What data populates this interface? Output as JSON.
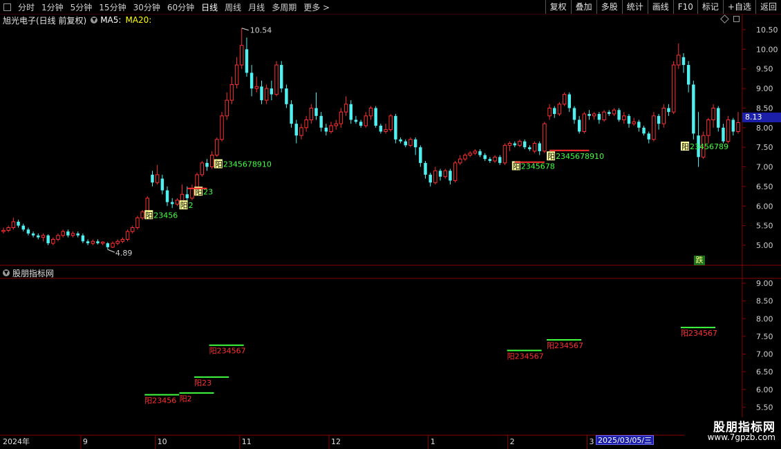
{
  "toolbar": {
    "periods": [
      "分时",
      "1分钟",
      "5分钟",
      "15分钟",
      "30分钟",
      "60分钟",
      "日线",
      "周线",
      "月线",
      "多周期",
      "更多 >"
    ],
    "active_period": "日线",
    "buttons": [
      "复权",
      "叠加",
      "多股",
      "统计",
      "画线",
      "F10",
      "标记",
      "+自选",
      "返回"
    ]
  },
  "info": {
    "stock_name": "旭光电子(日线 前复权)",
    "ma5_label": "MA5:",
    "ma20_label": "MA20:"
  },
  "indicator": {
    "name": "股朋指标网"
  },
  "colors": {
    "up": "#ff3030",
    "down": "#50f0f0",
    "grid": "#8a0000",
    "ma5": "#ffffff",
    "ma20": "#ffff00",
    "green_text": "#40ff40",
    "red_text": "#ff3030",
    "yang_bg": "#ffff99"
  },
  "price_axis": [
    "10.50",
    "10.00",
    "9.50",
    "9.00",
    "8.50",
    "8.00",
    "7.50",
    "7.00",
    "6.50",
    "6.00",
    "5.50",
    "5.00"
  ],
  "indicator_axis": [
    "9.00",
    "8.50",
    "8.00",
    "7.50",
    "7.00",
    "6.50",
    "6.00",
    "5.50",
    "5.00"
  ],
  "current_price": "8.13",
  "x_labels": [
    "2024年",
    "9",
    "10",
    "11",
    "12",
    "1",
    "2",
    "3"
  ],
  "cursor_date": "2025/03/05/三",
  "high_label": "10.54",
  "low_label": "4.89",
  "fall_badge": "跌",
  "main_markers": [
    {
      "yang": "阳",
      "text": "2345678910",
      "color": "green"
    },
    {
      "yang": "阳",
      "text": "23456",
      "color": "green"
    },
    {
      "yang": "阳",
      "text": "2",
      "color": "green"
    },
    {
      "yang": "阳",
      "text": "23",
      "color": "green"
    },
    {
      "yang": "阳",
      "text": "2345678",
      "color": "green"
    },
    {
      "yang": "阳",
      "text": "2345678910",
      "color": "green"
    },
    {
      "yang": "阳",
      "text": "23456789",
      "color": "green"
    }
  ],
  "indicator_markers": [
    {
      "text": "阳23456"
    },
    {
      "text": "阳2"
    },
    {
      "text": "阳23"
    },
    {
      "text": "阳234567"
    },
    {
      "text": "阳234567"
    },
    {
      "text": "阳234567"
    },
    {
      "text": "阳234567"
    }
  ],
  "watermark": {
    "line1": "股朋指标网",
    "line2": "www.7gpzb.com"
  },
  "chart_data": {
    "type": "candlestick",
    "title": "旭光电子(日线 前复权)",
    "ylim": [
      4.6,
      10.7
    ],
    "categories": [
      "2024-08",
      "2024-09",
      "2024-10",
      "2024-11",
      "2024-12",
      "2025-01",
      "2025-02",
      "2025-03"
    ],
    "annotations": {
      "max": 10.54,
      "min": 4.89,
      "last": 8.13
    },
    "series": [
      {
        "name": "",
        "values": [
          {
            "o": 5.35,
            "c": 5.38,
            "h": 5.45,
            "l": 5.3
          },
          {
            "o": 5.38,
            "c": 5.45,
            "h": 5.5,
            "l": 5.33
          },
          {
            "o": 5.45,
            "c": 5.6,
            "h": 5.7,
            "l": 5.4
          },
          {
            "o": 5.6,
            "c": 5.5,
            "h": 5.65,
            "l": 5.45
          },
          {
            "o": 5.5,
            "c": 5.4,
            "h": 5.55,
            "l": 5.35
          },
          {
            "o": 5.4,
            "c": 5.3,
            "h": 5.45,
            "l": 5.25
          },
          {
            "o": 5.3,
            "c": 5.25,
            "h": 5.35,
            "l": 5.2
          },
          {
            "o": 5.25,
            "c": 5.2,
            "h": 5.3,
            "l": 5.15
          },
          {
            "o": 5.2,
            "c": 5.25,
            "h": 5.3,
            "l": 5.1
          },
          {
            "o": 5.25,
            "c": 5.05,
            "h": 5.28,
            "l": 5.0
          },
          {
            "o": 5.05,
            "c": 5.15,
            "h": 5.2,
            "l": 5.0
          },
          {
            "o": 5.15,
            "c": 5.25,
            "h": 5.3,
            "l": 5.1
          },
          {
            "o": 5.25,
            "c": 5.35,
            "h": 5.4,
            "l": 5.2
          },
          {
            "o": 5.35,
            "c": 5.25,
            "h": 5.4,
            "l": 5.2
          },
          {
            "o": 5.25,
            "c": 5.3,
            "h": 5.35,
            "l": 5.2
          },
          {
            "o": 5.3,
            "c": 5.25,
            "h": 5.35,
            "l": 5.2
          },
          {
            "o": 5.25,
            "c": 5.1,
            "h": 5.3,
            "l": 5.05
          },
          {
            "o": 5.1,
            "c": 5.05,
            "h": 5.15,
            "l": 5.0
          },
          {
            "o": 5.05,
            "c": 5.1,
            "h": 5.15,
            "l": 5.0
          },
          {
            "o": 5.1,
            "c": 5.05,
            "h": 5.15,
            "l": 5.02
          },
          {
            "o": 5.05,
            "c": 5.08,
            "h": 5.1,
            "l": 5.0
          },
          {
            "o": 5.05,
            "c": 4.95,
            "h": 5.08,
            "l": 4.89
          },
          {
            "o": 4.95,
            "c": 5.05,
            "h": 5.1,
            "l": 4.93
          },
          {
            "o": 5.05,
            "c": 5.1,
            "h": 5.15,
            "l": 5.0
          },
          {
            "o": 5.1,
            "c": 5.15,
            "h": 5.2,
            "l": 5.05
          },
          {
            "o": 5.15,
            "c": 5.35,
            "h": 5.4,
            "l": 5.1
          },
          {
            "o": 5.35,
            "c": 5.45,
            "h": 5.5,
            "l": 5.3
          },
          {
            "o": 5.45,
            "c": 5.7,
            "h": 5.75,
            "l": 5.4
          },
          {
            "o": 5.7,
            "c": 5.85,
            "h": 5.9,
            "l": 5.65
          },
          {
            "o": 5.85,
            "c": 6.2,
            "h": 6.25,
            "l": 5.8
          },
          {
            "o": 6.8,
            "c": 6.6,
            "h": 6.9,
            "l": 6.5
          },
          {
            "o": 6.6,
            "c": 6.8,
            "h": 7.05,
            "l": 6.55
          },
          {
            "o": 6.7,
            "c": 6.4,
            "h": 6.8,
            "l": 6.3
          },
          {
            "o": 6.4,
            "c": 6.1,
            "h": 6.5,
            "l": 6.0
          },
          {
            "o": 6.1,
            "c": 6.05,
            "h": 6.2,
            "l": 5.95
          },
          {
            "o": 6.05,
            "c": 6.15,
            "h": 6.2,
            "l": 6.0
          },
          {
            "o": 6.1,
            "c": 6.3,
            "h": 6.55,
            "l": 6.0
          },
          {
            "o": 6.3,
            "c": 6.2,
            "h": 6.5,
            "l": 6.1
          },
          {
            "o": 6.2,
            "c": 6.45,
            "h": 6.55,
            "l": 6.15
          },
          {
            "o": 6.45,
            "c": 6.8,
            "h": 6.85,
            "l": 6.4
          },
          {
            "o": 6.8,
            "c": 7.1,
            "h": 7.15,
            "l": 6.75
          },
          {
            "o": 7.1,
            "c": 7.0,
            "h": 7.2,
            "l": 6.9
          },
          {
            "o": 7.0,
            "c": 7.3,
            "h": 7.4,
            "l": 6.95
          },
          {
            "o": 7.3,
            "c": 7.7,
            "h": 7.75,
            "l": 7.25
          },
          {
            "o": 7.7,
            "c": 8.3,
            "h": 8.4,
            "l": 7.65
          },
          {
            "o": 8.3,
            "c": 8.7,
            "h": 8.9,
            "l": 8.2
          },
          {
            "o": 8.7,
            "c": 9.1,
            "h": 9.3,
            "l": 8.6
          },
          {
            "o": 9.1,
            "c": 9.6,
            "h": 9.8,
            "l": 9.0
          },
          {
            "o": 9.6,
            "c": 10.1,
            "h": 10.54,
            "l": 9.5
          },
          {
            "o": 10.0,
            "c": 9.4,
            "h": 10.3,
            "l": 9.3
          },
          {
            "o": 9.4,
            "c": 9.0,
            "h": 9.6,
            "l": 8.8
          },
          {
            "o": 9.0,
            "c": 9.05,
            "h": 9.3,
            "l": 8.9
          },
          {
            "o": 9.05,
            "c": 8.7,
            "h": 9.2,
            "l": 8.6
          },
          {
            "o": 8.7,
            "c": 9.0,
            "h": 9.1,
            "l": 8.6
          },
          {
            "o": 9.0,
            "c": 8.85,
            "h": 9.2,
            "l": 8.7
          },
          {
            "o": 8.85,
            "c": 9.6,
            "h": 9.7,
            "l": 8.8
          },
          {
            "o": 9.6,
            "c": 9.0,
            "h": 9.7,
            "l": 8.9
          },
          {
            "o": 9.0,
            "c": 8.6,
            "h": 9.1,
            "l": 8.5
          },
          {
            "o": 8.6,
            "c": 8.1,
            "h": 8.7,
            "l": 8.0
          },
          {
            "o": 8.1,
            "c": 7.8,
            "h": 8.2,
            "l": 7.6
          },
          {
            "o": 7.8,
            "c": 8.0,
            "h": 8.1,
            "l": 7.7
          },
          {
            "o": 8.0,
            "c": 8.2,
            "h": 8.3,
            "l": 7.9
          },
          {
            "o": 8.2,
            "c": 8.5,
            "h": 8.6,
            "l": 8.1
          },
          {
            "o": 8.5,
            "c": 8.3,
            "h": 8.9,
            "l": 8.2
          },
          {
            "o": 8.3,
            "c": 8.0,
            "h": 8.4,
            "l": 7.9
          },
          {
            "o": 8.0,
            "c": 7.9,
            "h": 8.1,
            "l": 7.8
          },
          {
            "o": 7.9,
            "c": 8.05,
            "h": 8.15,
            "l": 7.85
          },
          {
            "o": 8.05,
            "c": 8.1,
            "h": 8.2,
            "l": 7.95
          },
          {
            "o": 8.1,
            "c": 8.4,
            "h": 8.5,
            "l": 8.0
          },
          {
            "o": 8.4,
            "c": 8.6,
            "h": 8.8,
            "l": 8.3
          },
          {
            "o": 8.6,
            "c": 8.2,
            "h": 8.7,
            "l": 8.1
          },
          {
            "o": 8.2,
            "c": 8.15,
            "h": 8.3,
            "l": 8.1
          },
          {
            "o": 8.15,
            "c": 8.05,
            "h": 8.2,
            "l": 8.0
          },
          {
            "o": 8.05,
            "c": 8.3,
            "h": 8.4,
            "l": 8.0
          },
          {
            "o": 8.3,
            "c": 8.5,
            "h": 8.55,
            "l": 8.2
          },
          {
            "o": 8.5,
            "c": 8.05,
            "h": 8.55,
            "l": 8.0
          },
          {
            "o": 8.05,
            "c": 7.9,
            "h": 8.1,
            "l": 7.85
          },
          {
            "o": 7.9,
            "c": 7.95,
            "h": 8.1,
            "l": 7.85
          },
          {
            "o": 7.95,
            "c": 8.3,
            "h": 8.35,
            "l": 7.9
          },
          {
            "o": 8.3,
            "c": 7.7,
            "h": 8.35,
            "l": 7.6
          },
          {
            "o": 7.7,
            "c": 7.65,
            "h": 7.75,
            "l": 7.6
          },
          {
            "o": 7.65,
            "c": 7.55,
            "h": 7.7,
            "l": 7.5
          },
          {
            "o": 7.55,
            "c": 7.7,
            "h": 7.75,
            "l": 7.5
          },
          {
            "o": 7.7,
            "c": 7.5,
            "h": 7.75,
            "l": 7.3
          },
          {
            "o": 7.5,
            "c": 7.1,
            "h": 7.55,
            "l": 7.0
          },
          {
            "o": 7.1,
            "c": 6.8,
            "h": 7.15,
            "l": 6.7
          },
          {
            "o": 6.8,
            "c": 6.6,
            "h": 6.85,
            "l": 6.5
          },
          {
            "o": 6.6,
            "c": 6.9,
            "h": 7.0,
            "l": 6.55
          },
          {
            "o": 6.9,
            "c": 6.75,
            "h": 6.95,
            "l": 6.65
          },
          {
            "o": 6.75,
            "c": 6.9,
            "h": 6.95,
            "l": 6.7
          },
          {
            "o": 6.9,
            "c": 6.65,
            "h": 6.95,
            "l": 6.55
          },
          {
            "o": 6.65,
            "c": 7.1,
            "h": 7.15,
            "l": 6.6
          },
          {
            "o": 7.1,
            "c": 7.2,
            "h": 7.3,
            "l": 7.05
          },
          {
            "o": 7.2,
            "c": 7.3,
            "h": 7.35,
            "l": 7.15
          },
          {
            "o": 7.3,
            "c": 7.35,
            "h": 7.4,
            "l": 7.25
          },
          {
            "o": 7.35,
            "c": 7.4,
            "h": 7.45,
            "l": 7.3
          },
          {
            "o": 7.4,
            "c": 7.3,
            "h": 7.45,
            "l": 7.25
          },
          {
            "o": 7.3,
            "c": 7.2,
            "h": 7.35,
            "l": 7.15
          },
          {
            "o": 7.2,
            "c": 7.15,
            "h": 7.25,
            "l": 7.1
          },
          {
            "o": 7.15,
            "c": 7.25,
            "h": 7.3,
            "l": 7.1
          },
          {
            "o": 7.25,
            "c": 7.1,
            "h": 7.3,
            "l": 7.05
          },
          {
            "o": 7.1,
            "c": 7.55,
            "h": 7.6,
            "l": 7.05
          },
          {
            "o": 7.55,
            "c": 7.6,
            "h": 7.65,
            "l": 7.4
          },
          {
            "o": 7.6,
            "c": 7.55,
            "h": 7.65,
            "l": 7.5
          },
          {
            "o": 7.55,
            "c": 7.65,
            "h": 7.7,
            "l": 7.5
          },
          {
            "o": 7.65,
            "c": 7.5,
            "h": 7.7,
            "l": 7.45
          },
          {
            "o": 7.5,
            "c": 7.45,
            "h": 7.55,
            "l": 7.4
          },
          {
            "o": 7.4,
            "c": 7.6,
            "h": 7.65,
            "l": 7.35
          },
          {
            "o": 7.6,
            "c": 7.4,
            "h": 7.65,
            "l": 7.3
          },
          {
            "o": 7.4,
            "c": 8.1,
            "h": 8.15,
            "l": 7.35
          },
          {
            "o": 8.3,
            "c": 8.5,
            "h": 8.6,
            "l": 8.2
          },
          {
            "o": 8.5,
            "c": 8.35,
            "h": 8.55,
            "l": 8.25
          },
          {
            "o": 8.35,
            "c": 8.6,
            "h": 8.65,
            "l": 8.3
          },
          {
            "o": 8.6,
            "c": 8.85,
            "h": 8.9,
            "l": 8.55
          },
          {
            "o": 8.85,
            "c": 8.5,
            "h": 8.9,
            "l": 8.4
          },
          {
            "o": 8.5,
            "c": 8.2,
            "h": 8.55,
            "l": 8.1
          },
          {
            "o": 8.2,
            "c": 7.9,
            "h": 8.3,
            "l": 7.85
          },
          {
            "o": 7.9,
            "c": 8.35,
            "h": 8.4,
            "l": 7.85
          },
          {
            "o": 8.35,
            "c": 8.3,
            "h": 8.45,
            "l": 8.2
          },
          {
            "o": 8.3,
            "c": 8.35,
            "h": 8.4,
            "l": 8.2
          },
          {
            "o": 8.35,
            "c": 8.2,
            "h": 8.4,
            "l": 8.1
          },
          {
            "o": 8.2,
            "c": 8.4,
            "h": 8.45,
            "l": 8.15
          },
          {
            "o": 8.4,
            "c": 8.35,
            "h": 8.45,
            "l": 8.3
          },
          {
            "o": 8.35,
            "c": 8.45,
            "h": 8.5,
            "l": 8.3
          },
          {
            "o": 8.45,
            "c": 8.2,
            "h": 8.5,
            "l": 8.15
          },
          {
            "o": 8.2,
            "c": 8.3,
            "h": 8.4,
            "l": 8.1
          },
          {
            "o": 8.3,
            "c": 8.1,
            "h": 8.35,
            "l": 8.0
          },
          {
            "o": 8.1,
            "c": 8.15,
            "h": 8.25,
            "l": 8.05
          },
          {
            "o": 8.15,
            "c": 8.0,
            "h": 8.2,
            "l": 7.9
          },
          {
            "o": 8.0,
            "c": 7.85,
            "h": 8.05,
            "l": 7.8
          },
          {
            "o": 7.85,
            "c": 7.7,
            "h": 7.9,
            "l": 7.6
          },
          {
            "o": 7.7,
            "c": 8.3,
            "h": 8.4,
            "l": 7.65
          },
          {
            "o": 8.3,
            "c": 8.1,
            "h": 8.35,
            "l": 7.95
          },
          {
            "o": 8.1,
            "c": 8.5,
            "h": 8.6,
            "l": 8.0
          },
          {
            "o": 8.5,
            "c": 8.4,
            "h": 8.6,
            "l": 8.3
          },
          {
            "o": 8.4,
            "c": 9.6,
            "h": 9.7,
            "l": 8.35
          },
          {
            "o": 9.6,
            "c": 9.85,
            "h": 10.15,
            "l": 9.5
          },
          {
            "o": 9.8,
            "c": 9.6,
            "h": 9.9,
            "l": 9.4
          },
          {
            "o": 9.6,
            "c": 9.1,
            "h": 9.7,
            "l": 8.9
          },
          {
            "o": 9.1,
            "c": 7.85,
            "h": 9.2,
            "l": 7.7
          },
          {
            "o": 7.8,
            "c": 7.25,
            "h": 8.4,
            "l": 7.0
          },
          {
            "o": 7.25,
            "c": 7.8,
            "h": 7.9,
            "l": 7.2
          },
          {
            "o": 7.8,
            "c": 8.2,
            "h": 8.25,
            "l": 7.6
          },
          {
            "o": 8.2,
            "c": 8.5,
            "h": 8.6,
            "l": 8.0
          },
          {
            "o": 8.5,
            "c": 8.0,
            "h": 8.55,
            "l": 7.9
          },
          {
            "o": 8.0,
            "c": 7.65,
            "h": 8.1,
            "l": 7.6
          },
          {
            "o": 7.65,
            "c": 8.2,
            "h": 8.3,
            "l": 7.6
          },
          {
            "o": 8.2,
            "c": 7.9,
            "h": 8.25,
            "l": 7.8
          },
          {
            "o": 7.9,
            "c": 8.13,
            "h": 8.4,
            "l": 7.85
          }
        ]
      }
    ]
  }
}
